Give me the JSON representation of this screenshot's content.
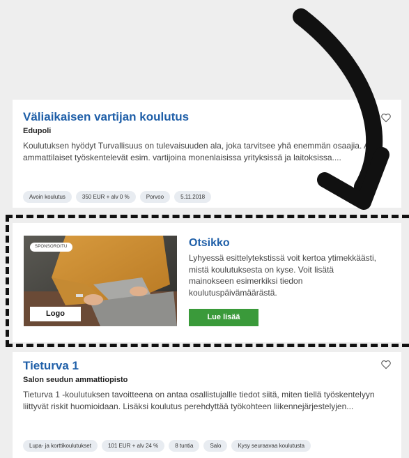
{
  "cards": [
    {
      "title": "Väliaikaisen vartijan koulutus",
      "provider": "Edupoli",
      "description": "Koulutuksen hyödyt Turvallisuus on tulevaisuuden ala, joka tarvitsee yhä enemmän osaajia. Alan ammattilaiset työskentelevät esim. vartijoina monenlaisissa yrityksissä ja laitoksissa....",
      "tags": [
        "Avoin koulutus",
        "350 EUR + alv 0 %",
        "Porvoo",
        "5.11.2018"
      ],
      "favorite_icon": "heart-icon"
    },
    {
      "title": "Tieturva 1",
      "provider": "Salon seudun ammattiopisto",
      "description": "Tieturva 1 -koulutuksen tavoitteena on antaa osallistujallle tiedot siitä, miten tiellä työskentelyyn liittyvät riskit huomioidaan. Lisäksi koulutus perehdyttää työkohteen liikennejärjestelyjen...",
      "tags": [
        "Lupa- ja korttikoulutukset",
        "101 EUR + alv 24 %",
        "8 tuntia",
        "Salo",
        "Kysy seuraavaa koulutusta"
      ],
      "favorite_icon": "heart-icon"
    }
  ],
  "ad": {
    "badge": "SPONSOROITU",
    "logo": "Logo",
    "title": "Otsikko",
    "description": "Lyhyessä esittelytekstissä voit kertoa ytimekkäästi, mistä koulutuksesta on kyse. Voit lisätä mainokseen esimerkiksi tiedon koulutuspäivämäärästä.",
    "button": "Lue lisää"
  },
  "colors": {
    "title_blue": "#1f5fa8",
    "button_green": "#3a9a3a",
    "tag_bg": "#e8ecf1",
    "page_bg": "#eeeeee"
  }
}
